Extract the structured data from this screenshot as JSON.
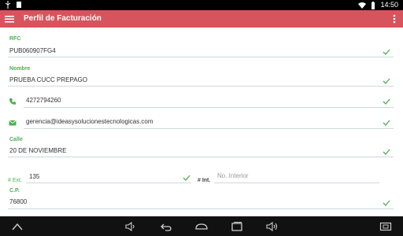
{
  "status_bar": {
    "time": "14:50"
  },
  "app_bar": {
    "title": "Perfil de Facturación"
  },
  "form": {
    "rfc_label": "RFC",
    "rfc_value": "PUB060907FG4",
    "nombre_label": "Nombre",
    "nombre_value": "PRUEBA CUCC PREPAGO",
    "phone_value": "4272794260",
    "email_value": "gerencia@ideasysolucionestecnologicas.com",
    "calle_label": "Calle",
    "calle_value": "20 DE NOVIEMBRE",
    "ext_label": "# Ext.",
    "ext_value": "135",
    "int_label": "# Int.",
    "int_placeholder": "No. Interior",
    "cp_label": "C.P.",
    "cp_value": "76800"
  },
  "colors": {
    "accent": "#d8545d",
    "label_green": "#4caf50",
    "line": "#cfd8dc"
  },
  "icons": {
    "status_left": [
      "usb-icon",
      "notification-icon"
    ],
    "status_right": [
      "wifi-icon",
      "battery-icon"
    ],
    "appbar": [
      "menu-icon",
      "more-vert-icon"
    ],
    "fields": [
      "phone-icon",
      "email-icon",
      "check-icon"
    ],
    "navbar": [
      "collapse-icon",
      "volume-down-icon",
      "back-icon",
      "home-icon",
      "recents-icon",
      "volume-up-icon",
      "screenshot-icon"
    ]
  }
}
